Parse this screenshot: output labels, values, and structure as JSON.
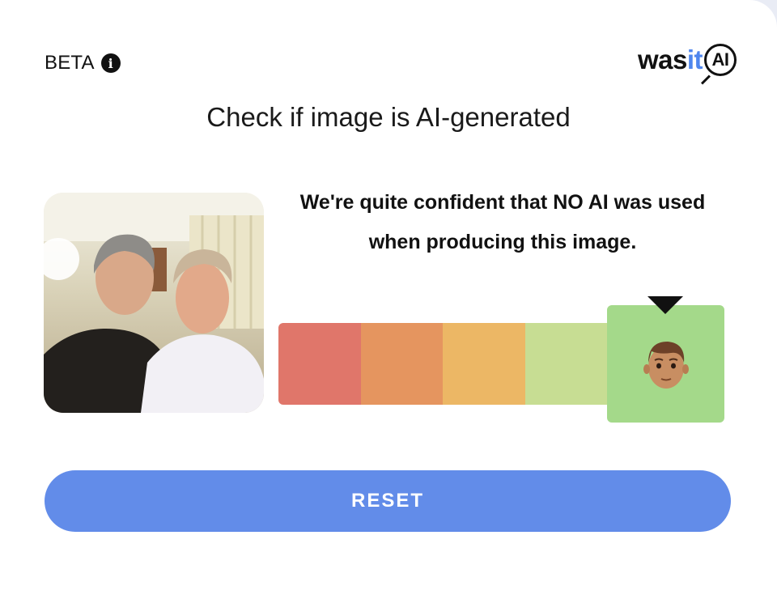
{
  "header": {
    "beta_label": "BETA",
    "info_icon": "info-icon",
    "logo": {
      "part1": "was",
      "part2": "it",
      "part3": "AI"
    }
  },
  "title": "Check if image is AI-generated",
  "result": {
    "verdict": "We're quite confident that NO AI was used when producing this image.",
    "scale_colors": [
      "#e0766a",
      "#e5955f",
      "#ecb765",
      "#c7dd93",
      "#a4d98a"
    ],
    "selected_level": 5,
    "level_count": 5,
    "indicator_icon": "man-emoji-icon"
  },
  "actions": {
    "reset_label": "RESET"
  },
  "colors": {
    "accent": "#628ce9",
    "logo_accent": "#4f86ee"
  }
}
